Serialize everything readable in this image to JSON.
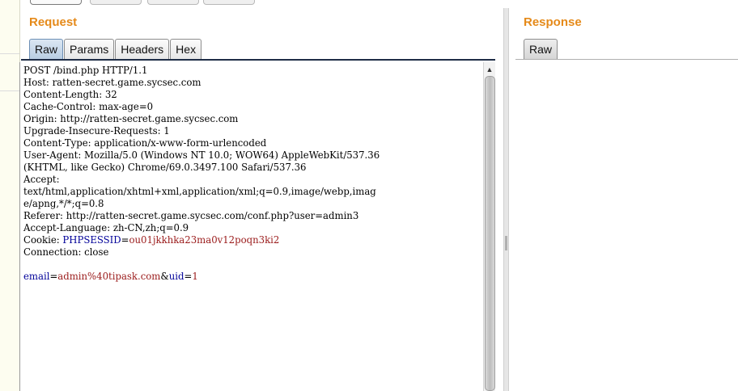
{
  "request": {
    "title": "Request",
    "tabs": [
      "Raw",
      "Params",
      "Headers",
      "Hex"
    ],
    "active_tab": "Raw",
    "start_line": "POST /bind.php HTTP/1.1",
    "headers": [
      "Host: ratten-secret.game.sycsec.com",
      "Content-Length: 32",
      "Cache-Control: max-age=0",
      "Origin: http://ratten-secret.game.sycsec.com",
      "Upgrade-Insecure-Requests: 1",
      "Content-Type: application/x-www-form-urlencoded",
      "User-Agent: Mozilla/5.0 (Windows NT 10.0; WOW64) AppleWebKit/537.36",
      "(KHTML, like Gecko) Chrome/69.0.3497.100 Safari/537.36",
      "Accept:",
      "text/html,application/xhtml+xml,application/xml;q=0.9,image/webp,imag",
      "e/apng,*/*;q=0.8",
      "Referer: http://ratten-secret.game.sycsec.com/conf.php?user=admin3",
      "Accept-Language: zh-CN,zh;q=0.9"
    ],
    "cookie": {
      "label": "Cookie: ",
      "name": "PHPSESSID",
      "eq": "=",
      "value": "ou01jkkhka23ma0v12poqn3ki2"
    },
    "connection": "Connection: close",
    "body": [
      {
        "key": "email",
        "value": "admin%40tipask.com"
      },
      {
        "key": "uid",
        "value": "1"
      }
    ]
  },
  "response": {
    "title": "Response",
    "tabs": [
      "Raw"
    ],
    "active_tab": "Raw"
  },
  "colors": {
    "title": "#e58a1a",
    "param_key": "#000099",
    "param_value": "#9a1a1a",
    "active_tab": "#c6d7ea"
  }
}
